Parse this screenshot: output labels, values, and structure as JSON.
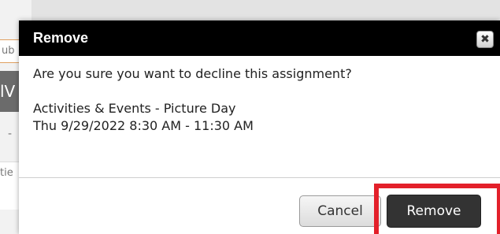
{
  "background": {
    "top_fragment": "ub",
    "dark_fragment": "lV",
    "dash_fragment": "-",
    "row_fragment": "tie"
  },
  "dialog": {
    "title": "Remove",
    "close_icon": "close-icon",
    "close_glyph": "✖",
    "question": "Are you sure you want to decline this assignment?",
    "event_name": "Activities & Events - Picture Day",
    "event_time": "Thu 9/29/2022 8:30 AM - 11:30 AM",
    "cancel_label": "Cancel",
    "remove_label": "Remove"
  },
  "colors": {
    "header_bg": "#000000",
    "remove_bg": "#333333",
    "highlight": "#e3202a"
  }
}
